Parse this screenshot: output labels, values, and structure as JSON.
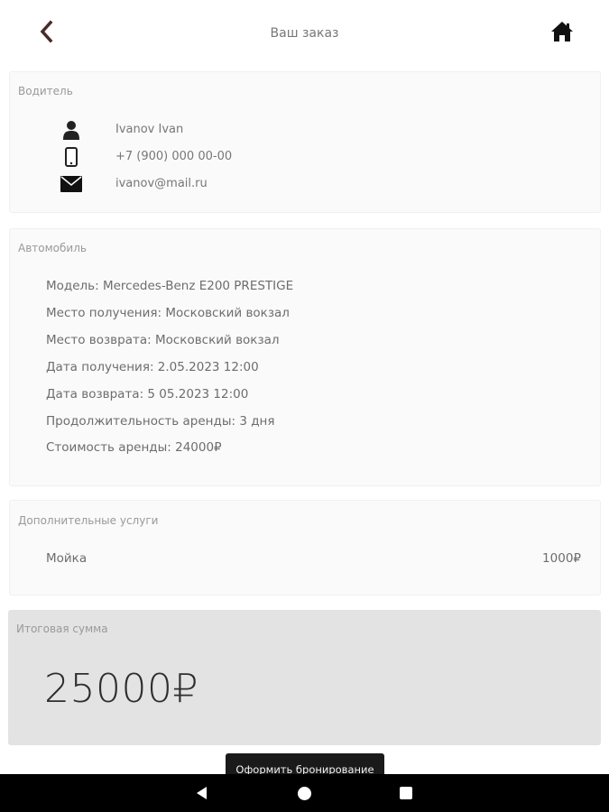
{
  "header": {
    "title": "Ваш заказ",
    "back_icon": "chevron-left-icon",
    "home_icon": "home-icon",
    "accent_color": "#4a2a2a"
  },
  "driver": {
    "section_title": "Водитель",
    "name": "Ivanov Ivan",
    "phone": "+7 (900) 000 00-00",
    "email": "ivanov@mail.ru"
  },
  "car": {
    "section_title": "Автомобиль",
    "lines": [
      "Модель: Mercedes-Benz E200 PRESTIGE",
      "Место получения: Московский вокзал",
      "Место возврата: Московский вокзал",
      "Дата получения: 2.05.2023 12:00",
      "Дата возврата: 5 05.2023 12:00",
      "Продолжительность аренды: 3 дня",
      "Стоимость аренды: 24000₽"
    ]
  },
  "services": {
    "section_title": "Дополнительные услуги",
    "items": [
      {
        "name": "Мойка",
        "price": "1000₽"
      }
    ]
  },
  "total": {
    "section_title": "Итоговая сумма",
    "amount": "25000₽"
  },
  "actions": {
    "book_label": "Оформить бронирование"
  }
}
